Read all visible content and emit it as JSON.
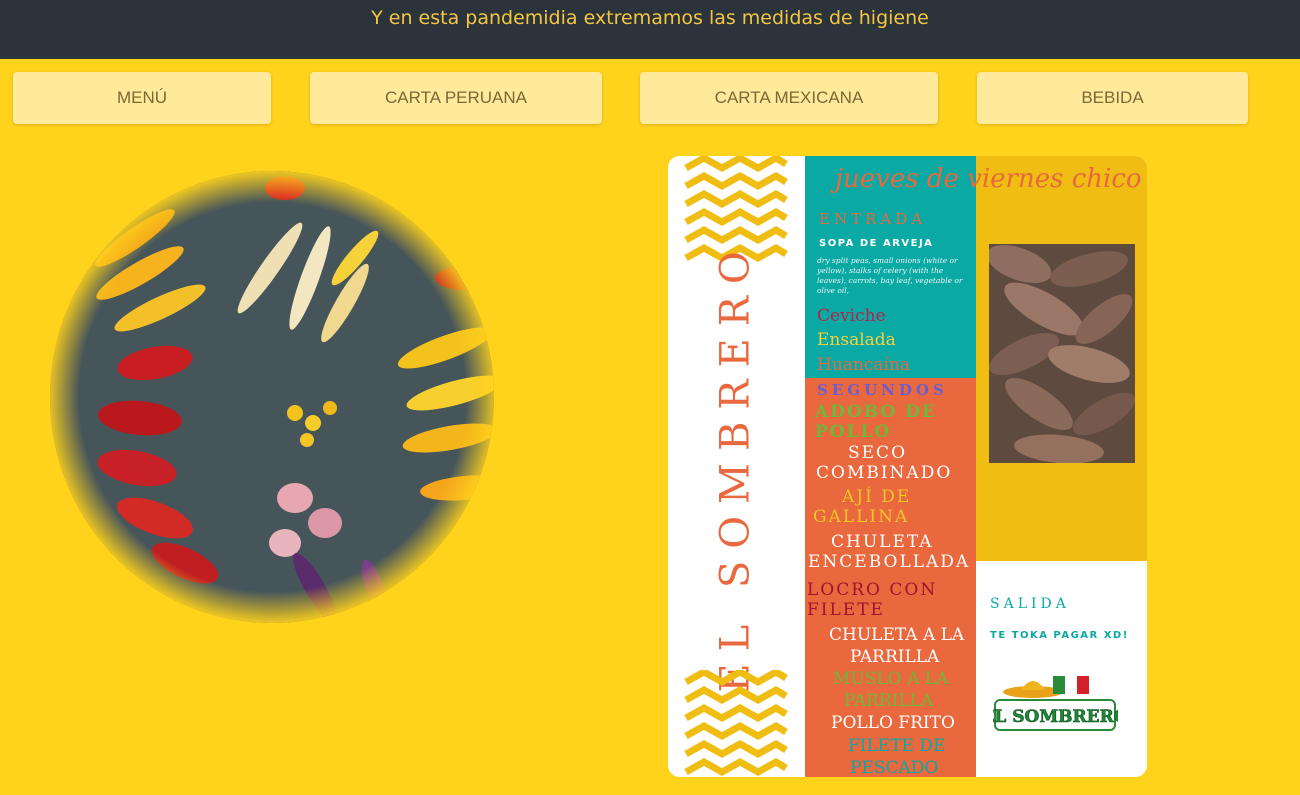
{
  "banner": {
    "message": "Y en esta pandemidia extremamos las medidas de higiene"
  },
  "nav": {
    "menu": "MENÚ",
    "carta_peruana": "CARTA PERUANA",
    "carta_mexicana": "CARTA MEXICANA",
    "bebida": "BEBIDA"
  },
  "colors": {
    "page_bg": "#ffd21c",
    "topbar_bg": "#2b343a",
    "banner_text": "#f5c542",
    "button_bg": "#ffe99a",
    "button_text": "#7a6a33",
    "teal": "#0aa9a4",
    "orange": "#e9683e",
    "gold": "#f0bd12"
  },
  "menu_card": {
    "brand_vertical": "EL SOMBRERO",
    "script_title": "jueves de viernes chico",
    "entrada_heading": "ENTRADA",
    "sopa_title": "SOPA DE ARVEJA",
    "sopa_description": "dry split peas, small onions (white or yellow), stalks of celery (with the leaves), carrots, bay leaf, vegetable or olive oil,",
    "entrada_items": [
      "Ceviche",
      "Ensalada",
      "Huancaína"
    ],
    "segundos_heading": "SEGUNDOS",
    "segundos_items": {
      "adobo_1": "ADOBO DE",
      "adobo_2": "POLLO",
      "seco_1": "SECO",
      "seco_2": "COMBINADO",
      "aji_1": "AJÍ DE",
      "aji_2": "GALLINA",
      "chuleta_1": "CHULETA",
      "chuleta_2": "ENCEBOLLADA",
      "locro_1": "LOCRO CON",
      "locro_2": "FILETE",
      "parrilla_1": "CHULETA A LA",
      "parrilla_2": "PARRILLA",
      "muslo_1": "MUSLO A LA",
      "muslo_2": "PARRILLA",
      "pollo_frito": "POLLO FRITO",
      "filete_1": "FILETE DE",
      "filete_2": "PESCADO"
    },
    "salida_heading": "SALIDA",
    "salida_text": "TE TOKA PAGAR XD!",
    "logo_text": "EL SOMBRERO"
  }
}
